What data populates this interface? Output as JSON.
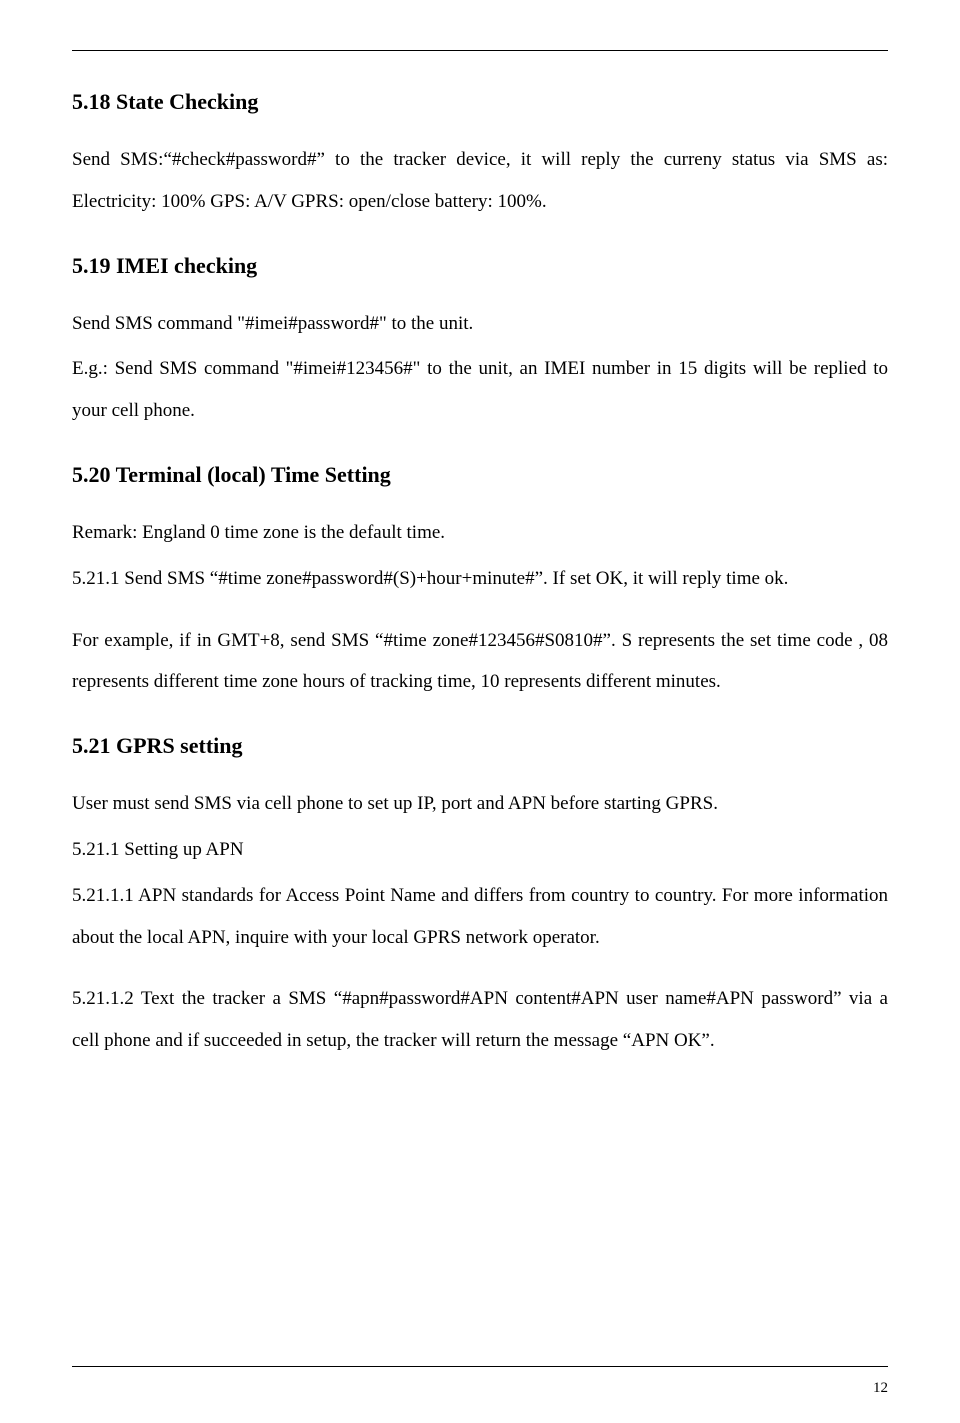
{
  "page_number": "12",
  "s518": {
    "heading": "5.18 State Checking",
    "p1": "Send SMS:“#check#password#” to the tracker device, it will reply the curreny status via SMS as: Electricity: 100% GPS: A/V GPRS: open/close battery: 100%."
  },
  "s519": {
    "heading": "5.19 IMEI checking",
    "p1": "Send SMS command \"#imei#password#\" to the unit.",
    "p2": "E.g.: Send SMS command \"#imei#123456#\" to the unit, an IMEI number in 15 digits will be replied to your cell phone."
  },
  "s520": {
    "heading": "5.20 Terminal (local) Time Setting",
    "p1": "Remark: England 0 time zone is the default time.",
    "p2": "5.21.1 Send SMS “#time zone#password#(S)+hour+minute#”. If set OK, it will reply time ok.",
    "p3": "For example, if in GMT+8, send SMS “#time zone#123456#S0810#”. S represents the set time code , 08 represents different time zone hours of tracking time, 10 represents different minutes."
  },
  "s521": {
    "heading": "5.21 GPRS setting",
    "p1": "User must send SMS via cell phone to set up IP, port and APN before starting GPRS.",
    "p2": "5.21.1 Setting up APN",
    "p3": "5.21.1.1 APN standards for Access Point Name and differs from country to country. For more information about the local APN, inquire with your local GPRS network operator.",
    "p4": "5.21.1.2 Text the tracker a SMS “#apn#password#APN content#APN user name#APN password” via a cell phone and if succeeded in setup, the tracker will return the message “APN OK”."
  }
}
